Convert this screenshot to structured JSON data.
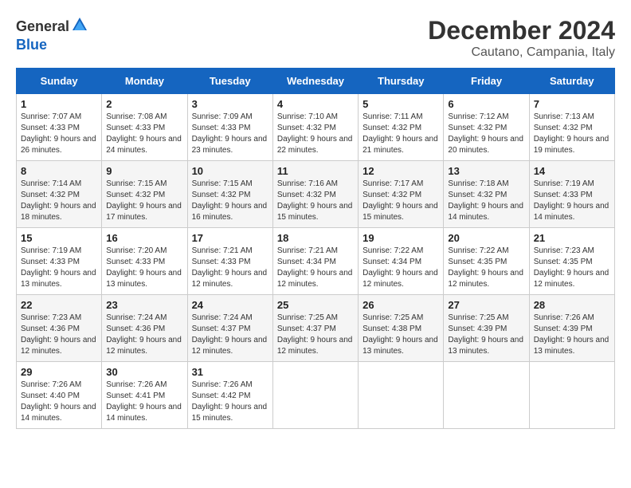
{
  "header": {
    "logo_general": "General",
    "logo_blue": "Blue",
    "title": "December 2024",
    "subtitle": "Cautano, Campania, Italy"
  },
  "weekdays": [
    "Sunday",
    "Monday",
    "Tuesday",
    "Wednesday",
    "Thursday",
    "Friday",
    "Saturday"
  ],
  "weeks": [
    [
      {
        "day": "1",
        "sunrise": "7:07 AM",
        "sunset": "4:33 PM",
        "daylight": "9 hours and 26 minutes."
      },
      {
        "day": "2",
        "sunrise": "7:08 AM",
        "sunset": "4:33 PM",
        "daylight": "9 hours and 24 minutes."
      },
      {
        "day": "3",
        "sunrise": "7:09 AM",
        "sunset": "4:33 PM",
        "daylight": "9 hours and 23 minutes."
      },
      {
        "day": "4",
        "sunrise": "7:10 AM",
        "sunset": "4:32 PM",
        "daylight": "9 hours and 22 minutes."
      },
      {
        "day": "5",
        "sunrise": "7:11 AM",
        "sunset": "4:32 PM",
        "daylight": "9 hours and 21 minutes."
      },
      {
        "day": "6",
        "sunrise": "7:12 AM",
        "sunset": "4:32 PM",
        "daylight": "9 hours and 20 minutes."
      },
      {
        "day": "7",
        "sunrise": "7:13 AM",
        "sunset": "4:32 PM",
        "daylight": "9 hours and 19 minutes."
      }
    ],
    [
      {
        "day": "8",
        "sunrise": "7:14 AM",
        "sunset": "4:32 PM",
        "daylight": "9 hours and 18 minutes."
      },
      {
        "day": "9",
        "sunrise": "7:15 AM",
        "sunset": "4:32 PM",
        "daylight": "9 hours and 17 minutes."
      },
      {
        "day": "10",
        "sunrise": "7:15 AM",
        "sunset": "4:32 PM",
        "daylight": "9 hours and 16 minutes."
      },
      {
        "day": "11",
        "sunrise": "7:16 AM",
        "sunset": "4:32 PM",
        "daylight": "9 hours and 15 minutes."
      },
      {
        "day": "12",
        "sunrise": "7:17 AM",
        "sunset": "4:32 PM",
        "daylight": "9 hours and 15 minutes."
      },
      {
        "day": "13",
        "sunrise": "7:18 AM",
        "sunset": "4:32 PM",
        "daylight": "9 hours and 14 minutes."
      },
      {
        "day": "14",
        "sunrise": "7:19 AM",
        "sunset": "4:33 PM",
        "daylight": "9 hours and 14 minutes."
      }
    ],
    [
      {
        "day": "15",
        "sunrise": "7:19 AM",
        "sunset": "4:33 PM",
        "daylight": "9 hours and 13 minutes."
      },
      {
        "day": "16",
        "sunrise": "7:20 AM",
        "sunset": "4:33 PM",
        "daylight": "9 hours and 13 minutes."
      },
      {
        "day": "17",
        "sunrise": "7:21 AM",
        "sunset": "4:33 PM",
        "daylight": "9 hours and 12 minutes."
      },
      {
        "day": "18",
        "sunrise": "7:21 AM",
        "sunset": "4:34 PM",
        "daylight": "9 hours and 12 minutes."
      },
      {
        "day": "19",
        "sunrise": "7:22 AM",
        "sunset": "4:34 PM",
        "daylight": "9 hours and 12 minutes."
      },
      {
        "day": "20",
        "sunrise": "7:22 AM",
        "sunset": "4:35 PM",
        "daylight": "9 hours and 12 minutes."
      },
      {
        "day": "21",
        "sunrise": "7:23 AM",
        "sunset": "4:35 PM",
        "daylight": "9 hours and 12 minutes."
      }
    ],
    [
      {
        "day": "22",
        "sunrise": "7:23 AM",
        "sunset": "4:36 PM",
        "daylight": "9 hours and 12 minutes."
      },
      {
        "day": "23",
        "sunrise": "7:24 AM",
        "sunset": "4:36 PM",
        "daylight": "9 hours and 12 minutes."
      },
      {
        "day": "24",
        "sunrise": "7:24 AM",
        "sunset": "4:37 PM",
        "daylight": "9 hours and 12 minutes."
      },
      {
        "day": "25",
        "sunrise": "7:25 AM",
        "sunset": "4:37 PM",
        "daylight": "9 hours and 12 minutes."
      },
      {
        "day": "26",
        "sunrise": "7:25 AM",
        "sunset": "4:38 PM",
        "daylight": "9 hours and 13 minutes."
      },
      {
        "day": "27",
        "sunrise": "7:25 AM",
        "sunset": "4:39 PM",
        "daylight": "9 hours and 13 minutes."
      },
      {
        "day": "28",
        "sunrise": "7:26 AM",
        "sunset": "4:39 PM",
        "daylight": "9 hours and 13 minutes."
      }
    ],
    [
      {
        "day": "29",
        "sunrise": "7:26 AM",
        "sunset": "4:40 PM",
        "daylight": "9 hours and 14 minutes."
      },
      {
        "day": "30",
        "sunrise": "7:26 AM",
        "sunset": "4:41 PM",
        "daylight": "9 hours and 14 minutes."
      },
      {
        "day": "31",
        "sunrise": "7:26 AM",
        "sunset": "4:42 PM",
        "daylight": "9 hours and 15 minutes."
      },
      null,
      null,
      null,
      null
    ]
  ],
  "labels": {
    "sunrise": "Sunrise: ",
    "sunset": "Sunset: ",
    "daylight": "Daylight: "
  }
}
